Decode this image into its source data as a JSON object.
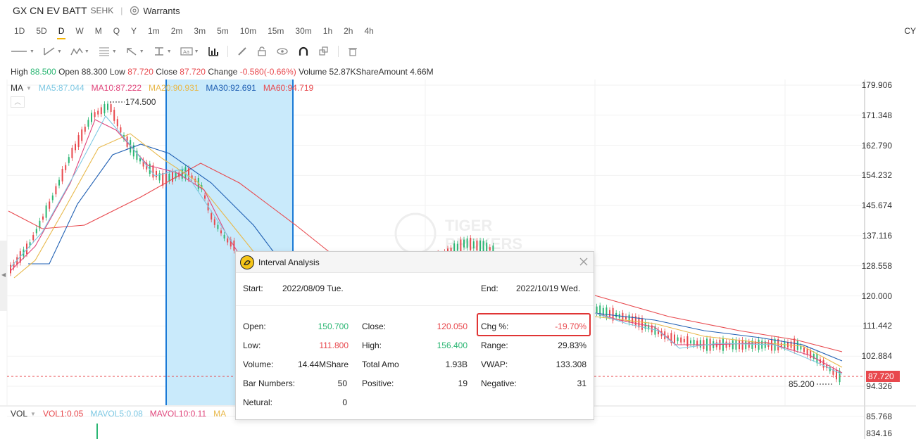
{
  "header": {
    "symbol": "GX CN EV BATT",
    "exchange": "SEHK",
    "warrants_label": "Warrants"
  },
  "periods": [
    "1D",
    "5D",
    "D",
    "W",
    "M",
    "Q",
    "Y",
    "1m",
    "2m",
    "3m",
    "5m",
    "10m",
    "15m",
    "30m",
    "1h",
    "2h",
    "4h"
  ],
  "active_period": "D",
  "right_cut_label": "CY",
  "ohlc": {
    "high_label": "High",
    "high": "88.500",
    "open_label": "Open",
    "open": "88.300",
    "low_label": "Low",
    "low": "87.720",
    "close_label": "Close",
    "close": "87.720",
    "change_label": "Change",
    "change": "-0.580(-0.66%)",
    "volume_label": "Volume",
    "volume": "52.87KShare",
    "amount_label": "Amount",
    "amount": "4.66M"
  },
  "ma_legend": {
    "label": "MA",
    "ma5": "MA5:87.044",
    "ma10": "MA10:87.222",
    "ma20": "MA20:90.931",
    "ma30": "MA30:92.691",
    "ma60": "MA60:94.719"
  },
  "colors": {
    "ma5": "#7ec8e3",
    "ma10": "#e0457b",
    "ma20": "#e8b84a",
    "ma30": "#1f5fb3",
    "ma60": "#e8484d",
    "up": "#2bb673",
    "down": "#e8484d",
    "selection": "#c6e9fb",
    "selection_edge": "#1a7ad6"
  },
  "price_axis": [
    "179.906",
    "171.348",
    "162.790",
    "154.232",
    "145.674",
    "137.116",
    "128.558",
    "120.000",
    "111.442",
    "102.884",
    "94.326",
    "85.768"
  ],
  "current_price_tag": "87.720",
  "chart_annotations": {
    "high_mark": "174.500",
    "low_mark": "85.200"
  },
  "vol_legend": {
    "label": "VOL",
    "vol1": "VOL1:0.05",
    "mavol5": "MAVOL5:0.08",
    "mavol10": "MAVOL10:0.11",
    "mavol20_cut": "MA"
  },
  "vol_axis_top": "834.16",
  "watermark": {
    "line1": "TIGER",
    "line2": "BROKERS"
  },
  "dialog": {
    "title": "Interval Analysis",
    "start_label": "Start:",
    "start_value": "2022/08/09 Tue.",
    "end_label": "End:",
    "end_value": "2022/10/19 Wed.",
    "open_label": "Open:",
    "open_value": "150.700",
    "close_label": "Close:",
    "close_value": "120.050",
    "chg_label": "Chg %:",
    "chg_value": "-19.70%",
    "low_label": "Low:",
    "low_value": "111.800",
    "high_label": "High:",
    "high_value": "156.400",
    "range_label": "Range:",
    "range_value": "29.83%",
    "volume_label": "Volume:",
    "volume_value": "14.44MShare",
    "amount_label": "Total Amo",
    "amount_value": "1.93B",
    "vwap_label": "VWAP:",
    "vwap_value": "133.308",
    "bars_label": "Bar Numbers:",
    "bars_value": "50",
    "positive_label": "Positive:",
    "positive_value": "19",
    "negative_label": "Negative:",
    "negative_value": "31",
    "neutral_label": "Netural:",
    "neutral_value": "0"
  }
}
